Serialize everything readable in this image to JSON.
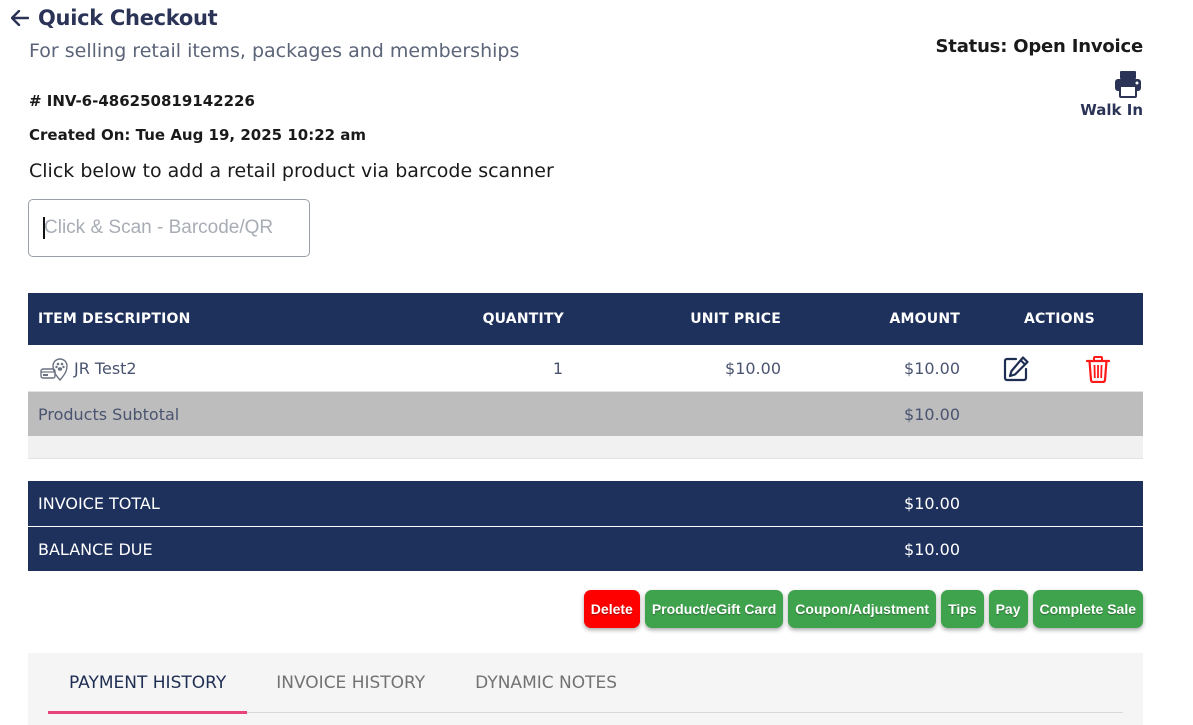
{
  "header": {
    "title": "Quick Checkout",
    "subtitle": "For selling retail items, packages and memberships",
    "status": "Status: Open Invoice",
    "customer": "Walk In"
  },
  "invoice": {
    "number": "# INV-6-486250819142226",
    "created": "Created On: Tue Aug 19, 2025 10:22 am"
  },
  "scan": {
    "hint": "Click below to add a retail product via barcode scanner",
    "placeholder": "Click & Scan - Barcode/QR",
    "value": ""
  },
  "table": {
    "columns": [
      "ITEM DESCRIPTION",
      "QUANTITY",
      "UNIT PRICE",
      "AMOUNT",
      "ACTIONS"
    ],
    "rows": [
      {
        "description": "JR Test2",
        "quantity": "1",
        "unit_price": "$10.00",
        "amount": "$10.00"
      }
    ],
    "subtotal_label": "Products Subtotal",
    "subtotal_value": "$10.00"
  },
  "totals": {
    "invoice_total_label": "INVOICE TOTAL",
    "invoice_total_value": "$10.00",
    "balance_due_label": "BALANCE DUE",
    "balance_due_value": "$10.00"
  },
  "buttons": {
    "delete": "Delete",
    "product": "Product/eGift Card",
    "coupon": "Coupon/Adjustment",
    "tips": "Tips",
    "pay": "Pay",
    "complete": "Complete Sale"
  },
  "tabs": [
    {
      "label": "PAYMENT HISTORY",
      "active": true
    },
    {
      "label": "INVOICE HISTORY",
      "active": false
    },
    {
      "label": "DYNAMIC NOTES",
      "active": false
    }
  ],
  "icons": {
    "back": "arrow-left-icon",
    "print": "printer-icon",
    "product": "product-gift-icon",
    "edit": "edit-icon",
    "delete": "trash-icon"
  },
  "colors": {
    "header_navy": "#1e315c",
    "subtotal_gray": "#bdbdbd",
    "delete_red": "#ff0000",
    "action_green": "#3fa34d",
    "tab_underline": "#e8437d"
  }
}
